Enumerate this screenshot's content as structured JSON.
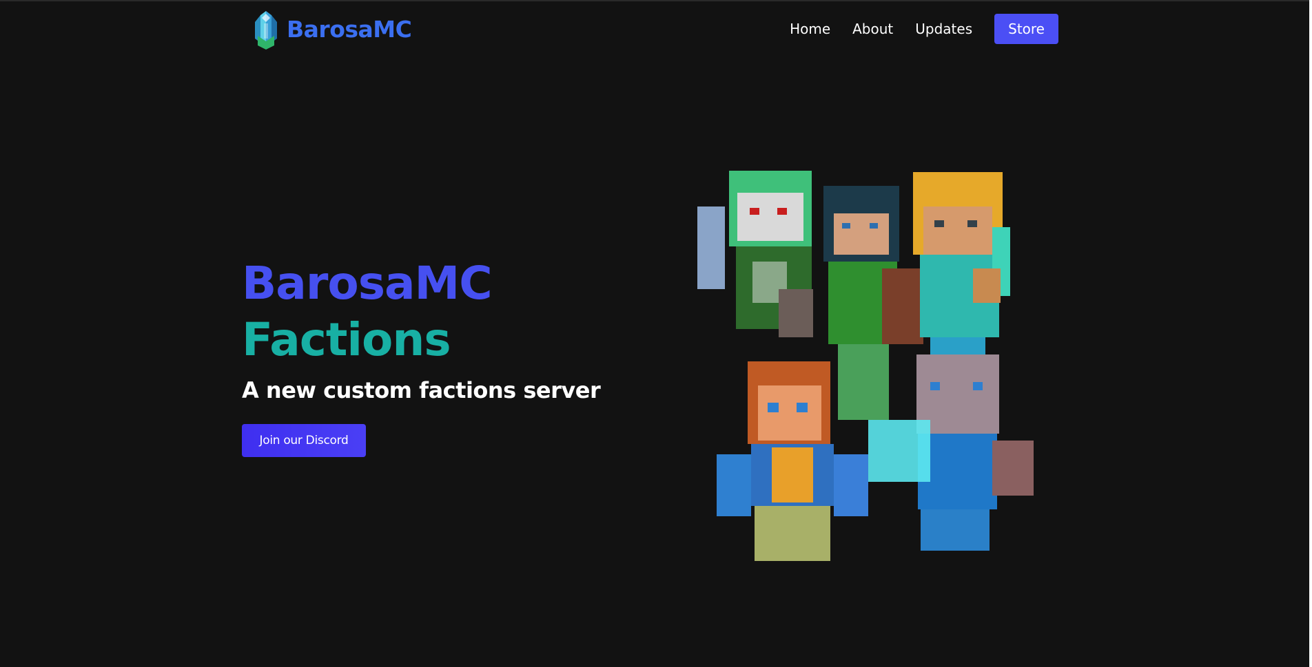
{
  "header": {
    "brand_name": "BarosaMC",
    "nav": [
      "Home",
      "About",
      "Updates"
    ],
    "store_label": "Store"
  },
  "hero": {
    "title_line1": "BarosaMC",
    "title_line2": "Factions",
    "subtitle": "A new custom factions server",
    "cta_label": "Join our Discord",
    "image_alt": "minecraft-characters-illustration"
  },
  "colors": {
    "background": "#121212",
    "brand": "#3b6ff0",
    "title_primary": "#4650f0",
    "title_secondary": "#18b0a4",
    "button": "#4b4ff5"
  }
}
